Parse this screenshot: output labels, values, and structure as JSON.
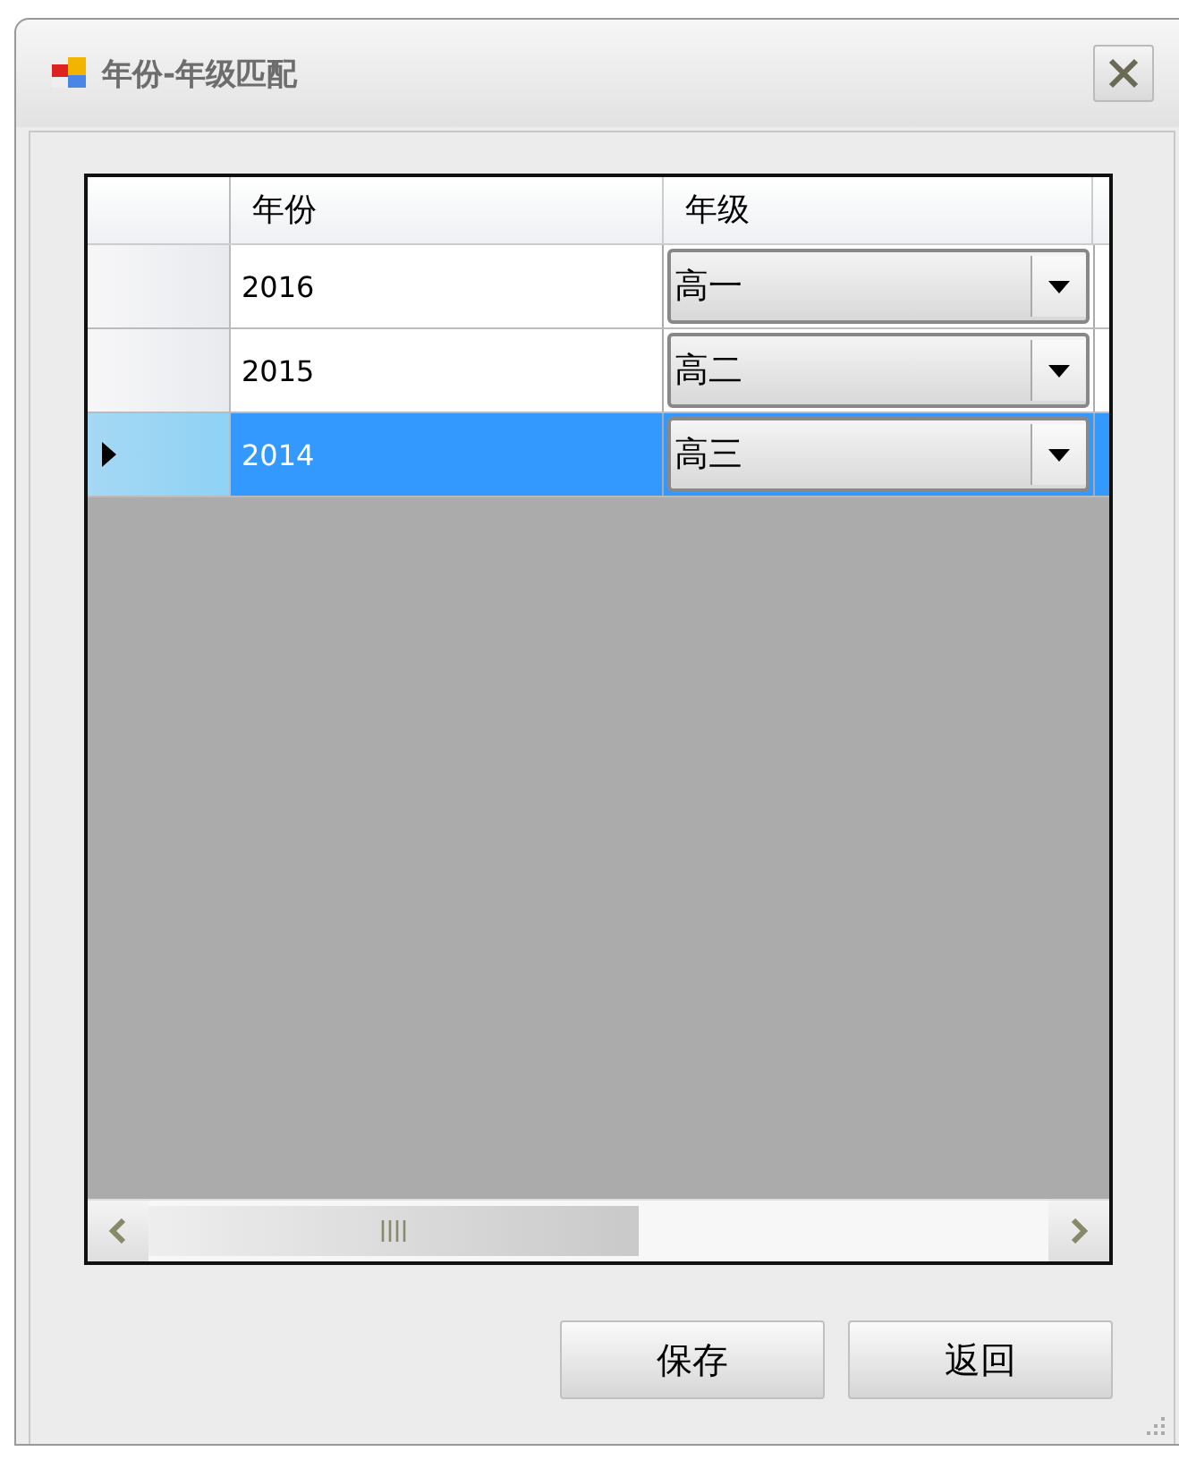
{
  "window": {
    "title": "年份-年级匹配"
  },
  "table": {
    "columns": [
      "年份",
      "年级"
    ],
    "rows": [
      {
        "year": "2016",
        "grade": "高一",
        "selected": false
      },
      {
        "year": "2015",
        "grade": "高二",
        "selected": false
      },
      {
        "year": "2014",
        "grade": "高三",
        "selected": true
      }
    ]
  },
  "buttons": [
    "保存",
    "返回"
  ]
}
